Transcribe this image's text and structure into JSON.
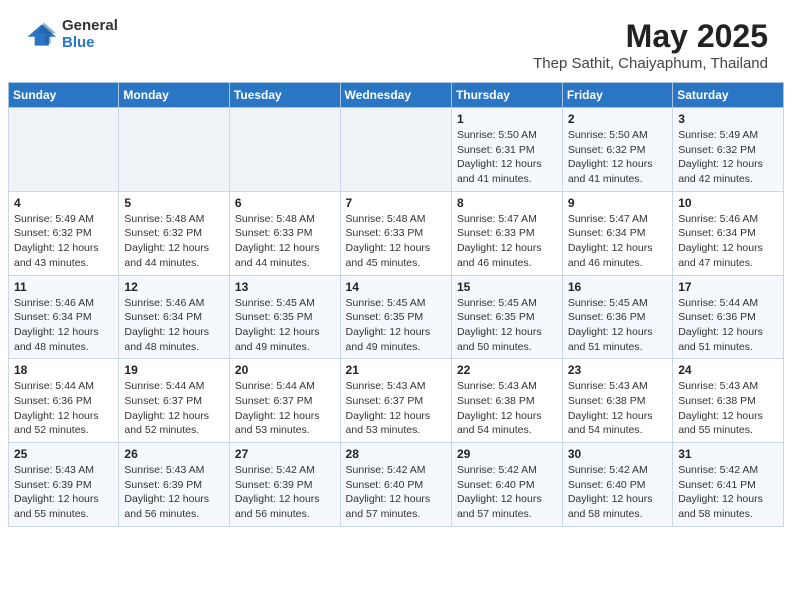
{
  "header": {
    "logo_line1": "General",
    "logo_line2": "Blue",
    "title": "May 2025",
    "subtitle": "Thep Sathit, Chaiyaphum, Thailand"
  },
  "weekdays": [
    "Sunday",
    "Monday",
    "Tuesday",
    "Wednesday",
    "Thursday",
    "Friday",
    "Saturday"
  ],
  "weeks": [
    [
      {
        "day": "",
        "info": ""
      },
      {
        "day": "",
        "info": ""
      },
      {
        "day": "",
        "info": ""
      },
      {
        "day": "",
        "info": ""
      },
      {
        "day": "1",
        "info": "Sunrise: 5:50 AM\nSunset: 6:31 PM\nDaylight: 12 hours and 41 minutes."
      },
      {
        "day": "2",
        "info": "Sunrise: 5:50 AM\nSunset: 6:32 PM\nDaylight: 12 hours and 41 minutes."
      },
      {
        "day": "3",
        "info": "Sunrise: 5:49 AM\nSunset: 6:32 PM\nDaylight: 12 hours and 42 minutes."
      }
    ],
    [
      {
        "day": "4",
        "info": "Sunrise: 5:49 AM\nSunset: 6:32 PM\nDaylight: 12 hours and 43 minutes."
      },
      {
        "day": "5",
        "info": "Sunrise: 5:48 AM\nSunset: 6:32 PM\nDaylight: 12 hours and 44 minutes."
      },
      {
        "day": "6",
        "info": "Sunrise: 5:48 AM\nSunset: 6:33 PM\nDaylight: 12 hours and 44 minutes."
      },
      {
        "day": "7",
        "info": "Sunrise: 5:48 AM\nSunset: 6:33 PM\nDaylight: 12 hours and 45 minutes."
      },
      {
        "day": "8",
        "info": "Sunrise: 5:47 AM\nSunset: 6:33 PM\nDaylight: 12 hours and 46 minutes."
      },
      {
        "day": "9",
        "info": "Sunrise: 5:47 AM\nSunset: 6:34 PM\nDaylight: 12 hours and 46 minutes."
      },
      {
        "day": "10",
        "info": "Sunrise: 5:46 AM\nSunset: 6:34 PM\nDaylight: 12 hours and 47 minutes."
      }
    ],
    [
      {
        "day": "11",
        "info": "Sunrise: 5:46 AM\nSunset: 6:34 PM\nDaylight: 12 hours and 48 minutes."
      },
      {
        "day": "12",
        "info": "Sunrise: 5:46 AM\nSunset: 6:34 PM\nDaylight: 12 hours and 48 minutes."
      },
      {
        "day": "13",
        "info": "Sunrise: 5:45 AM\nSunset: 6:35 PM\nDaylight: 12 hours and 49 minutes."
      },
      {
        "day": "14",
        "info": "Sunrise: 5:45 AM\nSunset: 6:35 PM\nDaylight: 12 hours and 49 minutes."
      },
      {
        "day": "15",
        "info": "Sunrise: 5:45 AM\nSunset: 6:35 PM\nDaylight: 12 hours and 50 minutes."
      },
      {
        "day": "16",
        "info": "Sunrise: 5:45 AM\nSunset: 6:36 PM\nDaylight: 12 hours and 51 minutes."
      },
      {
        "day": "17",
        "info": "Sunrise: 5:44 AM\nSunset: 6:36 PM\nDaylight: 12 hours and 51 minutes."
      }
    ],
    [
      {
        "day": "18",
        "info": "Sunrise: 5:44 AM\nSunset: 6:36 PM\nDaylight: 12 hours and 52 minutes."
      },
      {
        "day": "19",
        "info": "Sunrise: 5:44 AM\nSunset: 6:37 PM\nDaylight: 12 hours and 52 minutes."
      },
      {
        "day": "20",
        "info": "Sunrise: 5:44 AM\nSunset: 6:37 PM\nDaylight: 12 hours and 53 minutes."
      },
      {
        "day": "21",
        "info": "Sunrise: 5:43 AM\nSunset: 6:37 PM\nDaylight: 12 hours and 53 minutes."
      },
      {
        "day": "22",
        "info": "Sunrise: 5:43 AM\nSunset: 6:38 PM\nDaylight: 12 hours and 54 minutes."
      },
      {
        "day": "23",
        "info": "Sunrise: 5:43 AM\nSunset: 6:38 PM\nDaylight: 12 hours and 54 minutes."
      },
      {
        "day": "24",
        "info": "Sunrise: 5:43 AM\nSunset: 6:38 PM\nDaylight: 12 hours and 55 minutes."
      }
    ],
    [
      {
        "day": "25",
        "info": "Sunrise: 5:43 AM\nSunset: 6:39 PM\nDaylight: 12 hours and 55 minutes."
      },
      {
        "day": "26",
        "info": "Sunrise: 5:43 AM\nSunset: 6:39 PM\nDaylight: 12 hours and 56 minutes."
      },
      {
        "day": "27",
        "info": "Sunrise: 5:42 AM\nSunset: 6:39 PM\nDaylight: 12 hours and 56 minutes."
      },
      {
        "day": "28",
        "info": "Sunrise: 5:42 AM\nSunset: 6:40 PM\nDaylight: 12 hours and 57 minutes."
      },
      {
        "day": "29",
        "info": "Sunrise: 5:42 AM\nSunset: 6:40 PM\nDaylight: 12 hours and 57 minutes."
      },
      {
        "day": "30",
        "info": "Sunrise: 5:42 AM\nSunset: 6:40 PM\nDaylight: 12 hours and 58 minutes."
      },
      {
        "day": "31",
        "info": "Sunrise: 5:42 AM\nSunset: 6:41 PM\nDaylight: 12 hours and 58 minutes."
      }
    ]
  ]
}
